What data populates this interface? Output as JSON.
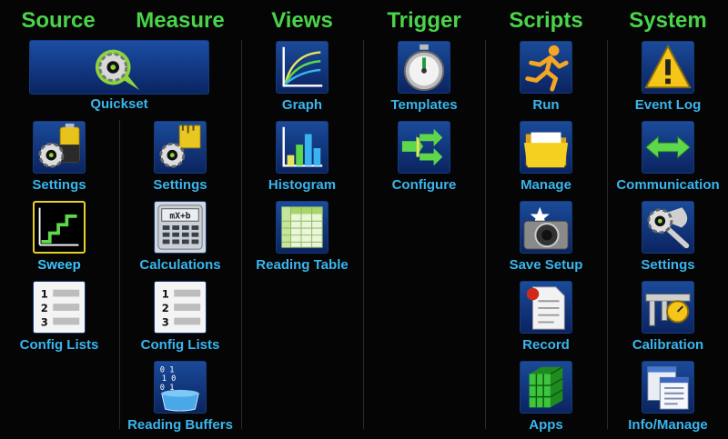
{
  "columns": [
    {
      "id": "source",
      "title": "Source"
    },
    {
      "id": "measure",
      "title": "Measure"
    },
    {
      "id": "views",
      "title": "Views"
    },
    {
      "id": "trigger",
      "title": "Trigger"
    },
    {
      "id": "scripts",
      "title": "Scripts"
    },
    {
      "id": "system",
      "title": "System"
    }
  ],
  "quickset": {
    "label": "Quickset",
    "icon": "quickset-gear-icon"
  },
  "source": {
    "settings": {
      "label": "Settings",
      "icon": "battery-gear-icon"
    },
    "sweep": {
      "label": "Sweep",
      "icon": "staircase-sweep-icon",
      "selected": true
    },
    "config_lists": {
      "label": "Config Lists",
      "icon": "numbered-list-icon"
    }
  },
  "measure": {
    "settings": {
      "label": "Settings",
      "icon": "ruler-gear-icon"
    },
    "calculations": {
      "label": "Calculations",
      "icon": "calculator-icon",
      "display": "mX+b"
    },
    "config_lists": {
      "label": "Config Lists",
      "icon": "numbered-list-icon"
    },
    "reading_buffers": {
      "label": "Reading Buffers",
      "icon": "binary-bucket-icon"
    }
  },
  "views": {
    "graph": {
      "label": "Graph",
      "icon": "graph-curves-icon"
    },
    "histogram": {
      "label": "Histogram",
      "icon": "bar-chart-icon"
    },
    "reading_table": {
      "label": "Reading Table",
      "icon": "table-grid-icon"
    }
  },
  "trigger": {
    "templates": {
      "label": "Templates",
      "icon": "stopwatch-icon"
    },
    "configure": {
      "label": "Configure",
      "icon": "flow-arrows-icon"
    }
  },
  "scripts": {
    "run": {
      "label": "Run",
      "icon": "runner-icon"
    },
    "manage": {
      "label": "Manage",
      "icon": "folder-icon"
    },
    "save_setup": {
      "label": "Save Setup",
      "icon": "camera-icon"
    },
    "record": {
      "label": "Record",
      "icon": "record-document-icon"
    },
    "apps": {
      "label": "Apps",
      "icon": "green-cube-icon"
    }
  },
  "system": {
    "event_log": {
      "label": "Event Log",
      "icon": "warning-triangle-icon"
    },
    "communication": {
      "label": "Communication",
      "icon": "double-arrow-icon"
    },
    "settings": {
      "label": "Settings",
      "icon": "wrench-gear-icon"
    },
    "calibration": {
      "label": "Calibration",
      "icon": "caliper-gauge-icon"
    },
    "info_manage": {
      "label": "Info/Manage",
      "icon": "windows-info-icon"
    }
  },
  "list_numbers": [
    "1",
    "2",
    "3"
  ],
  "colors": {
    "header": "#4ad44a",
    "label": "#39b6f0",
    "icon_bg": "#0b2460",
    "selected_border": "#e8d024"
  }
}
